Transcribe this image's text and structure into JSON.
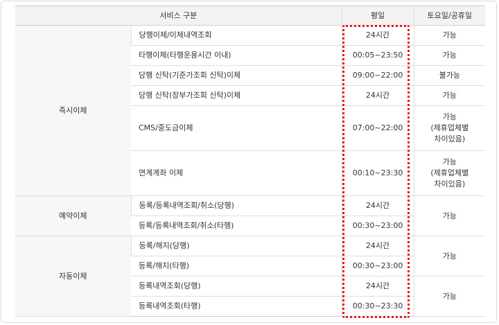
{
  "headers": {
    "service": "서비스 구분",
    "weekday": "평일",
    "weekend": "토요일/공휴일"
  },
  "groups": [
    {
      "category": "즉시이체",
      "rows": [
        {
          "service": "당행이체/이체내역조회",
          "weekday": "24시간",
          "weekend": "가능"
        },
        {
          "service": "타행이체(타행운용시간 이내)",
          "weekday": "00:05~23:50",
          "weekend": "가능"
        },
        {
          "service": "당행 신탁(기준가조회 신탁)이체",
          "weekday": "09:00~22:00",
          "weekend": "불가능"
        },
        {
          "service": "당행 신탁(장부가조회 신탁)이체",
          "weekday": "24시간",
          "weekend": "가능"
        },
        {
          "service": "CMS/중도금이체",
          "weekday": "07:00~22:00",
          "weekend_lines": [
            "가능",
            "(제휴업체별",
            "차이있음)"
          ]
        },
        {
          "service": "연계계좌 이체",
          "weekday": "00:10~23:30",
          "weekend_lines": [
            "가능",
            "(제휴업체별",
            "차이있음)"
          ]
        }
      ]
    },
    {
      "category": "예약이체",
      "weekend": "가능",
      "rows": [
        {
          "service": "등록/등록내역조회/취소(당행)",
          "weekday": "24시간"
        },
        {
          "service": "등록/등록내역조회/취소(타행)",
          "weekday": "00:30~23:00"
        }
      ]
    },
    {
      "category": "자동이체",
      "weekend_1": "가능",
      "weekend_2": "가능",
      "rows": [
        {
          "service": "등록/해지(당행)",
          "weekday": "24시간"
        },
        {
          "service": "등록/해지(타행)",
          "weekday": "00:30~23:00"
        },
        {
          "service": "등록내역조회(당행)",
          "weekday": "24시간"
        },
        {
          "service": "등록내역조회(타행)",
          "weekday": "00:30~23:30"
        }
      ]
    }
  ],
  "colors": {
    "highlight": "#e21a1a",
    "header_bg": "#f3f3f3",
    "border": "#dddddd"
  }
}
